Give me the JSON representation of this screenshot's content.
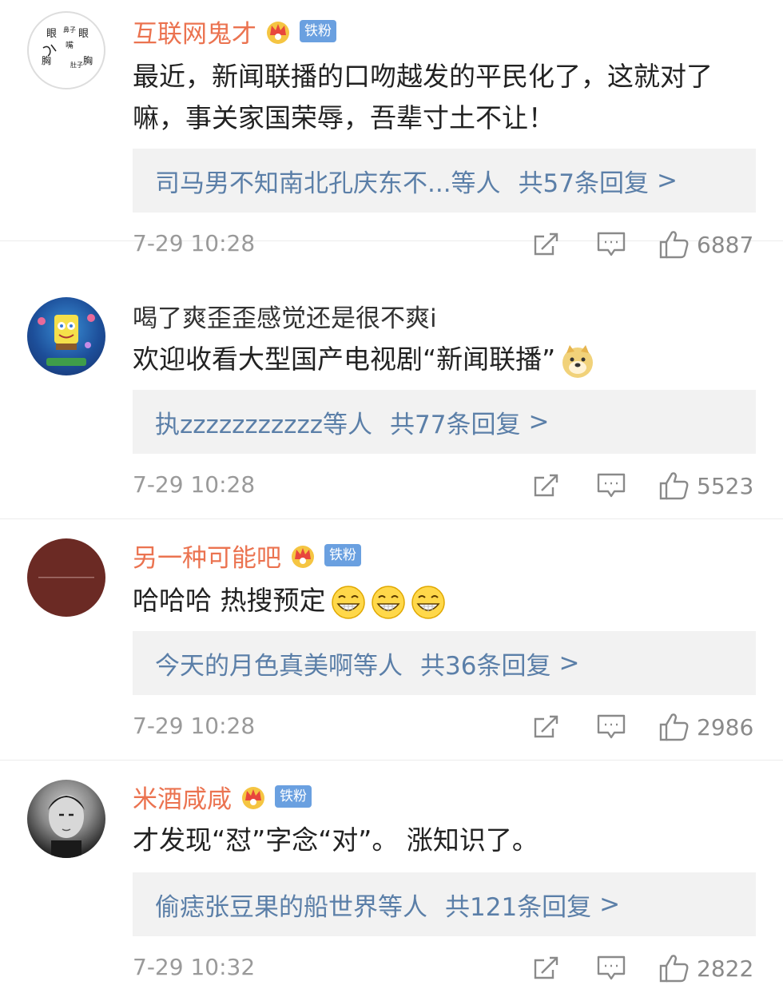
{
  "comments": [
    {
      "username": "互联网鬼才",
      "username_color": "#eb7350",
      "has_crown": true,
      "badge": "铁粉",
      "text": "最近，新闻联播的口吻越发的平民化了，这就对了嘛，事关家国荣辱，吾辈寸土不让！",
      "emoji_count": 0,
      "reply_users": "司马男不知南北孔庆东不...等人",
      "reply_count": "共57条回复",
      "timestamp": "7-29 10:28",
      "likes": "6887",
      "avatar_icon": "hand-drawn-text-avatar",
      "avatar_text": [
        "眼",
        "鼻子",
        "眼",
        "嘴",
        "胸",
        "胸",
        "肚子"
      ]
    },
    {
      "username": "喝了爽歪歪感觉还是很不爽i",
      "username_color": "#333333",
      "has_crown": false,
      "badge": "",
      "text": "欢迎收看大型国产电视剧“新闻联播”",
      "emoji_count": 1,
      "emoji_icon": "doge-emoji",
      "reply_users": "执zzzzzzzzzzz等人",
      "reply_count": "共77条回复",
      "timestamp": "7-29 10:28",
      "likes": "5523",
      "avatar_icon": "cartoon-avatar"
    },
    {
      "username": "另一种可能吧",
      "username_color": "#eb7350",
      "has_crown": true,
      "badge": "铁粉",
      "text": "哈哈哈  热搜预定",
      "emoji_count": 3,
      "emoji_icon": "grin-emoji",
      "reply_users": "今天的月色真美啊等人",
      "reply_count": "共36条回复",
      "timestamp": "7-29 10:28",
      "likes": "2986",
      "avatar_icon": "dark-red-avatar"
    },
    {
      "username": "米酒咸咸",
      "username_color": "#eb7350",
      "has_crown": true,
      "badge": "铁粉",
      "text": "才发现“怼”字念“对”。 涨知识了。",
      "emoji_count": 0,
      "reply_users": "偷痣张豆果的船世界等人",
      "reply_count": "共121条回复",
      "timestamp": "7-29 10:32",
      "likes": "2822",
      "avatar_icon": "photo-avatar"
    }
  ],
  "reply_arrow": ">",
  "icons": {
    "share": "share-icon",
    "comment": "comment-icon",
    "like": "like-icon",
    "crown": "crown-icon"
  },
  "colors": {
    "username_accent": "#eb7350",
    "link": "#5b7fa8",
    "badge": "#6aa0e0"
  }
}
